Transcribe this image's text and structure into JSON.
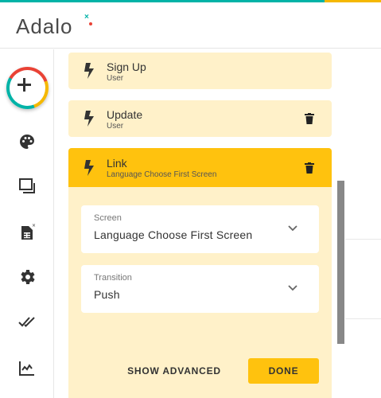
{
  "brand": {
    "name": "Adalo",
    "colors": {
      "teal": "#00b3a7",
      "yellow": "#f5b800",
      "red": "#e94235",
      "card": "#fff1c9",
      "card_active": "#ffc20e"
    }
  },
  "sidebar": {
    "add_button_icon": "plus-icon",
    "items": [
      {
        "icon": "palette-icon"
      },
      {
        "icon": "screens-icon"
      },
      {
        "icon": "database-icon"
      },
      {
        "icon": "gear-icon"
      },
      {
        "icon": "double-check-icon"
      },
      {
        "icon": "analytics-icon"
      }
    ]
  },
  "actions": [
    {
      "title": "Sign Up",
      "subtitle": "User",
      "icon": "lightning-icon"
    },
    {
      "title": "Update",
      "subtitle": "User",
      "icon": "lightning-icon",
      "deletable": true
    }
  ],
  "active_action": {
    "title": "Link",
    "subtitle": "Language Choose First Screen",
    "icon": "lightning-icon",
    "fields": [
      {
        "label": "Screen",
        "value": "Language Choose First Screen"
      },
      {
        "label": "Transition",
        "value": "Push"
      }
    ],
    "advanced_label": "SHOW ADVANCED",
    "done_label": "DONE"
  }
}
